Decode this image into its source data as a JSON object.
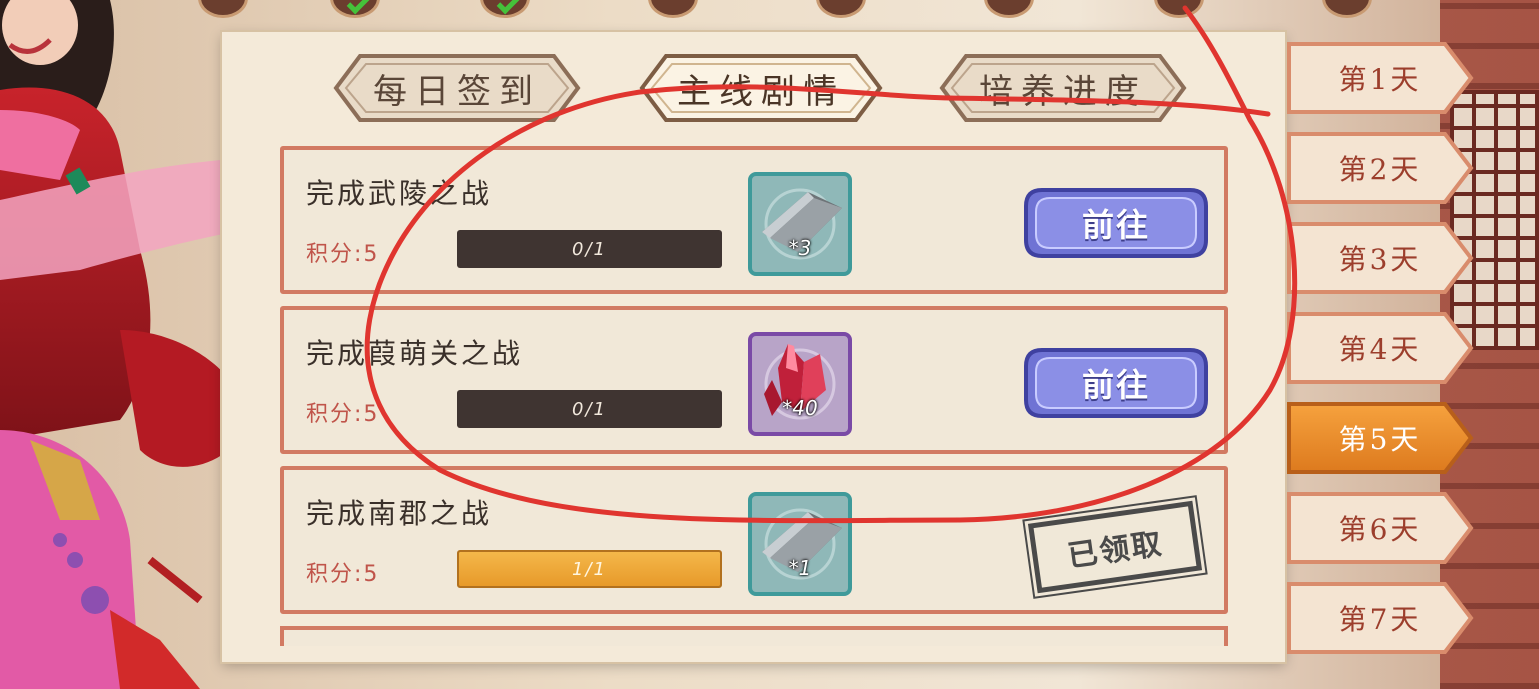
{
  "tabs": [
    {
      "label": "每日签到",
      "active": false
    },
    {
      "label": "主线剧情",
      "active": true
    },
    {
      "label": "培养进度",
      "active": false
    }
  ],
  "tasks": [
    {
      "title": "完成武陵之战",
      "points": "积分:5",
      "progress_text": "0/1",
      "progress_fraction": 0,
      "reward_icon": "silver-ingot-icon",
      "reward_count": "*3",
      "action": "前往",
      "claimed": false
    },
    {
      "title": "完成葭萌关之战",
      "points": "积分:5",
      "progress_text": "0/1",
      "progress_fraction": 0,
      "reward_icon": "red-crystal-icon",
      "reward_count": "*40",
      "action": "前往",
      "claimed": false
    },
    {
      "title": "完成南郡之战",
      "points": "积分:5",
      "progress_text": "1/1",
      "progress_fraction": 1,
      "reward_icon": "silver-ingot-icon",
      "reward_count": "*1",
      "action": "已领取",
      "claimed": true
    }
  ],
  "days": [
    {
      "label": "第1天",
      "active": false
    },
    {
      "label": "第2天",
      "active": false
    },
    {
      "label": "第3天",
      "active": false
    },
    {
      "label": "第4天",
      "active": false
    },
    {
      "label": "第5天",
      "active": true
    },
    {
      "label": "第6天",
      "active": false
    },
    {
      "label": "第7天",
      "active": false
    }
  ],
  "top_progress": [
    {
      "checked": false
    },
    {
      "checked": true
    },
    {
      "checked": true
    },
    {
      "checked": false
    },
    {
      "checked": false
    },
    {
      "checked": false
    },
    {
      "checked": false
    },
    {
      "checked": false
    }
  ],
  "colors": {
    "card_border": "#d27a62",
    "progress_done": "#e79a2a",
    "button_blue": "#6b6fd0",
    "day_active": "#e88a2c",
    "annotation_red": "#e0352f"
  }
}
